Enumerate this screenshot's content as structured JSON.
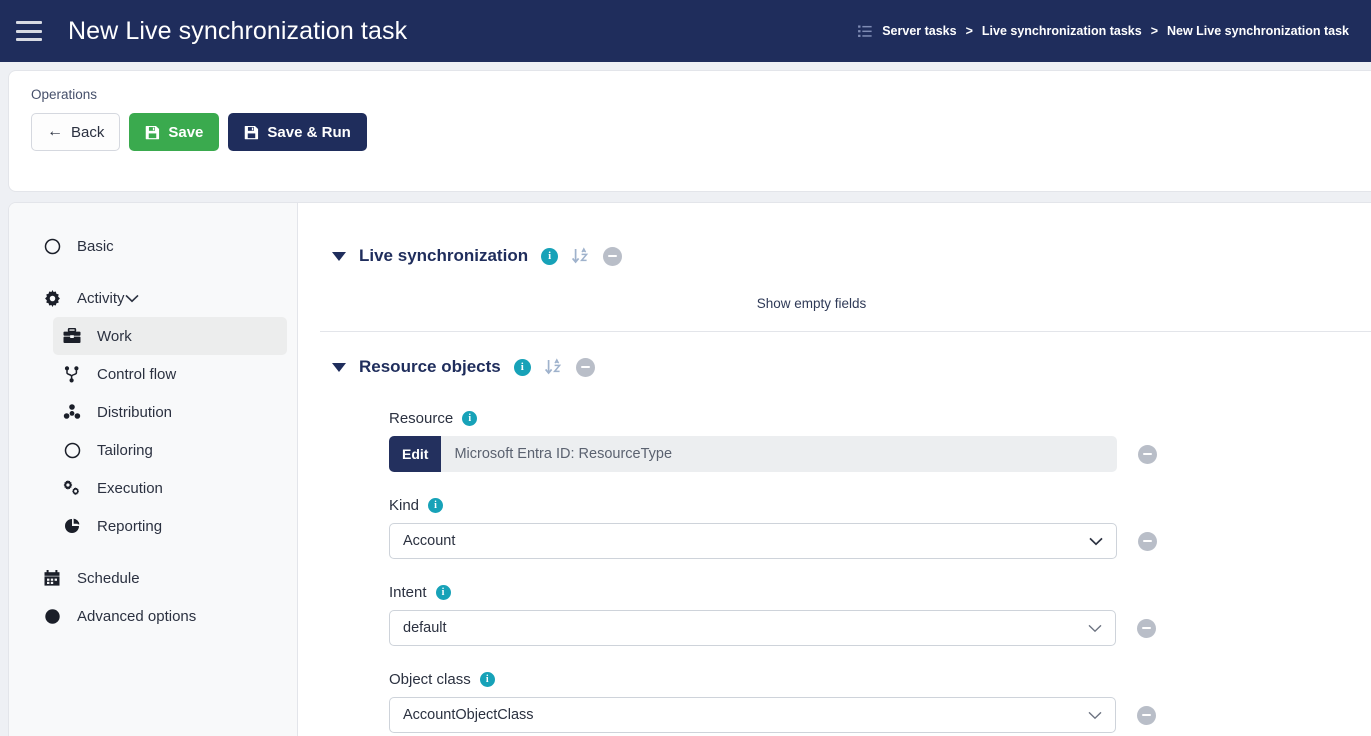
{
  "header": {
    "menu_icon": "hamburger-icon",
    "title": "New Live synchronization task",
    "breadcrumb_icon": "task-list-icon",
    "breadcrumb": [
      {
        "label": "Server tasks"
      },
      {
        "label": "Live synchronization tasks"
      },
      {
        "label": "New Live synchronization task"
      }
    ],
    "breadcrumb_separator": ">"
  },
  "operations": {
    "label": "Operations",
    "buttons": [
      {
        "label": "Back",
        "icon": "arrow-left-icon",
        "style": "outline"
      },
      {
        "label": "Save",
        "icon": "floppy-disk-icon",
        "style": "green"
      },
      {
        "label": "Save & Run",
        "icon": "floppy-disk-icon",
        "style": "navy"
      }
    ]
  },
  "sidebar": {
    "items": [
      {
        "label": "Basic",
        "icon": "circle-outline-icon",
        "level": "top",
        "active": false
      },
      {
        "label": "Activity",
        "icon": "gear-icon",
        "level": "top",
        "active": false,
        "expanded": true,
        "chevron": "chevron-down-icon"
      },
      {
        "label": "Work",
        "icon": "briefcase-icon",
        "level": "sub",
        "active": true
      },
      {
        "label": "Control flow",
        "icon": "branch-icon",
        "level": "sub",
        "active": false
      },
      {
        "label": "Distribution",
        "icon": "nodes-icon",
        "level": "sub",
        "active": false
      },
      {
        "label": "Tailoring",
        "icon": "circle-outline-icon",
        "level": "sub",
        "active": false
      },
      {
        "label": "Execution",
        "icon": "cogs-icon",
        "level": "sub",
        "active": false
      },
      {
        "label": "Reporting",
        "icon": "pie-chart-icon",
        "level": "sub",
        "active": false
      },
      {
        "label": "Schedule",
        "icon": "calendar-icon",
        "level": "top",
        "active": false
      },
      {
        "label": "Advanced options",
        "icon": "circle-filled-icon",
        "level": "top",
        "active": false
      }
    ]
  },
  "content": {
    "sections": [
      {
        "title": "Live synchronization",
        "caret": "caret-down-icon",
        "info_icon": "info-icon",
        "sort_icon": "sort-alpha-down-icon",
        "remove_icon": "minus-circle-icon"
      },
      {
        "title": "Resource objects",
        "caret": "caret-down-icon",
        "info_icon": "info-icon",
        "sort_icon": "sort-alpha-down-icon",
        "remove_icon": "minus-circle-icon"
      }
    ],
    "show_empty_fields": "Show empty fields",
    "fields": [
      {
        "label": "Resource",
        "info_icon": "info-icon",
        "type": "edit-input",
        "edit_label": "Edit",
        "value": "Microsoft Entra ID: ResourceType",
        "remove_icon": "minus-circle-icon"
      },
      {
        "label": "Kind",
        "info_icon": "info-icon",
        "type": "select",
        "value": "Account",
        "chevron": "chevron-down-icon",
        "remove_icon": "minus-circle-icon"
      },
      {
        "label": "Intent",
        "info_icon": "info-icon",
        "type": "select",
        "value": "default",
        "chevron": "chevron-down-icon",
        "remove_icon": "minus-circle-icon"
      },
      {
        "label": "Object class",
        "info_icon": "info-icon",
        "type": "select",
        "value": "AccountObjectClass",
        "chevron": "chevron-down-icon",
        "remove_icon": "minus-circle-icon"
      }
    ]
  },
  "colors": {
    "header_navy": "#1f2d5c",
    "save_green": "#3aaa4e",
    "info_teal": "#17a2b8",
    "page_bg": "#eef0f4",
    "active_nav": "#eceded",
    "muted_gray": "#b9bec8"
  },
  "info_char": "i"
}
